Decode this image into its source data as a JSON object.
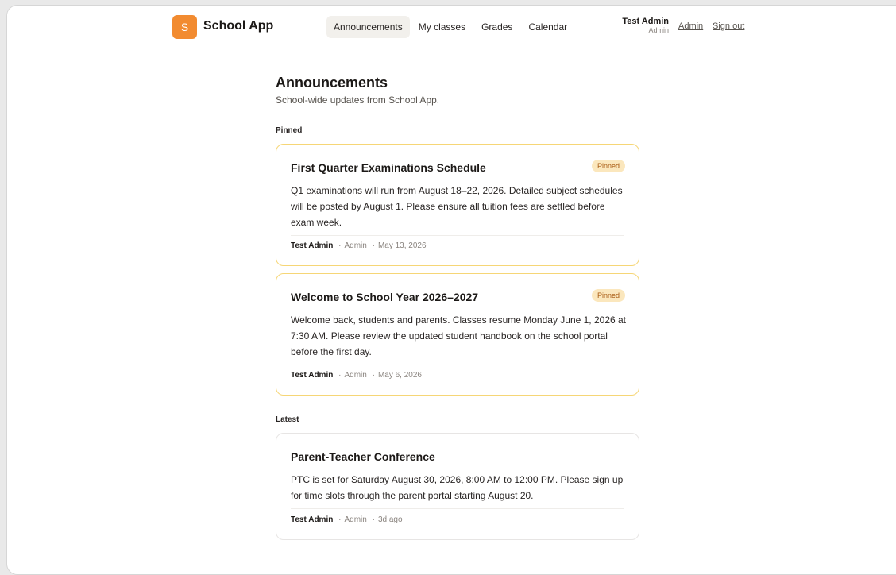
{
  "app": {
    "logo_letter": "S",
    "name": "School App"
  },
  "nav": {
    "items": [
      {
        "label": "Announcements",
        "active": true
      },
      {
        "label": "My classes",
        "active": false
      },
      {
        "label": "Grades",
        "active": false
      },
      {
        "label": "Calendar",
        "active": false
      }
    ]
  },
  "user": {
    "name": "Test Admin",
    "role": "Admin"
  },
  "header_links": {
    "admin": "Admin",
    "sign_out": "Sign out"
  },
  "page": {
    "title": "Announcements",
    "subtitle": "School-wide updates from School App."
  },
  "sections": {
    "pinned_label": "Pinned",
    "latest_label": "Latest"
  },
  "pinned": [
    {
      "title": "First Quarter Examinations Schedule",
      "badge": "Pinned",
      "body": "Q1 examinations will run from August 18–22, 2026. Detailed subject schedules will be posted by August 1. Please ensure all tuition fees are settled before exam week.",
      "author": "Test Admin",
      "role": "Admin",
      "date": "May 13, 2026"
    },
    {
      "title": "Welcome to School Year 2026–2027",
      "badge": "Pinned",
      "body": "Welcome back, students and parents. Classes resume Monday June 1, 2026 at 7:30 AM. Please review the updated student handbook on the school portal before the first day.",
      "author": "Test Admin",
      "role": "Admin",
      "date": "May 6, 2026"
    }
  ],
  "latest": [
    {
      "title": "Parent-Teacher Conference",
      "body": "PTC is set for Saturday August 30, 2026, 8:00 AM to 12:00 PM. Please sign up for time slots through the parent portal starting August 20.",
      "author": "Test Admin",
      "role": "Admin",
      "date": "3d ago"
    }
  ],
  "colors": {
    "accent": "#f28b30",
    "pinned_border": "#f6d676",
    "badge_bg": "#fbe7bd",
    "badge_text": "#a85a12"
  }
}
